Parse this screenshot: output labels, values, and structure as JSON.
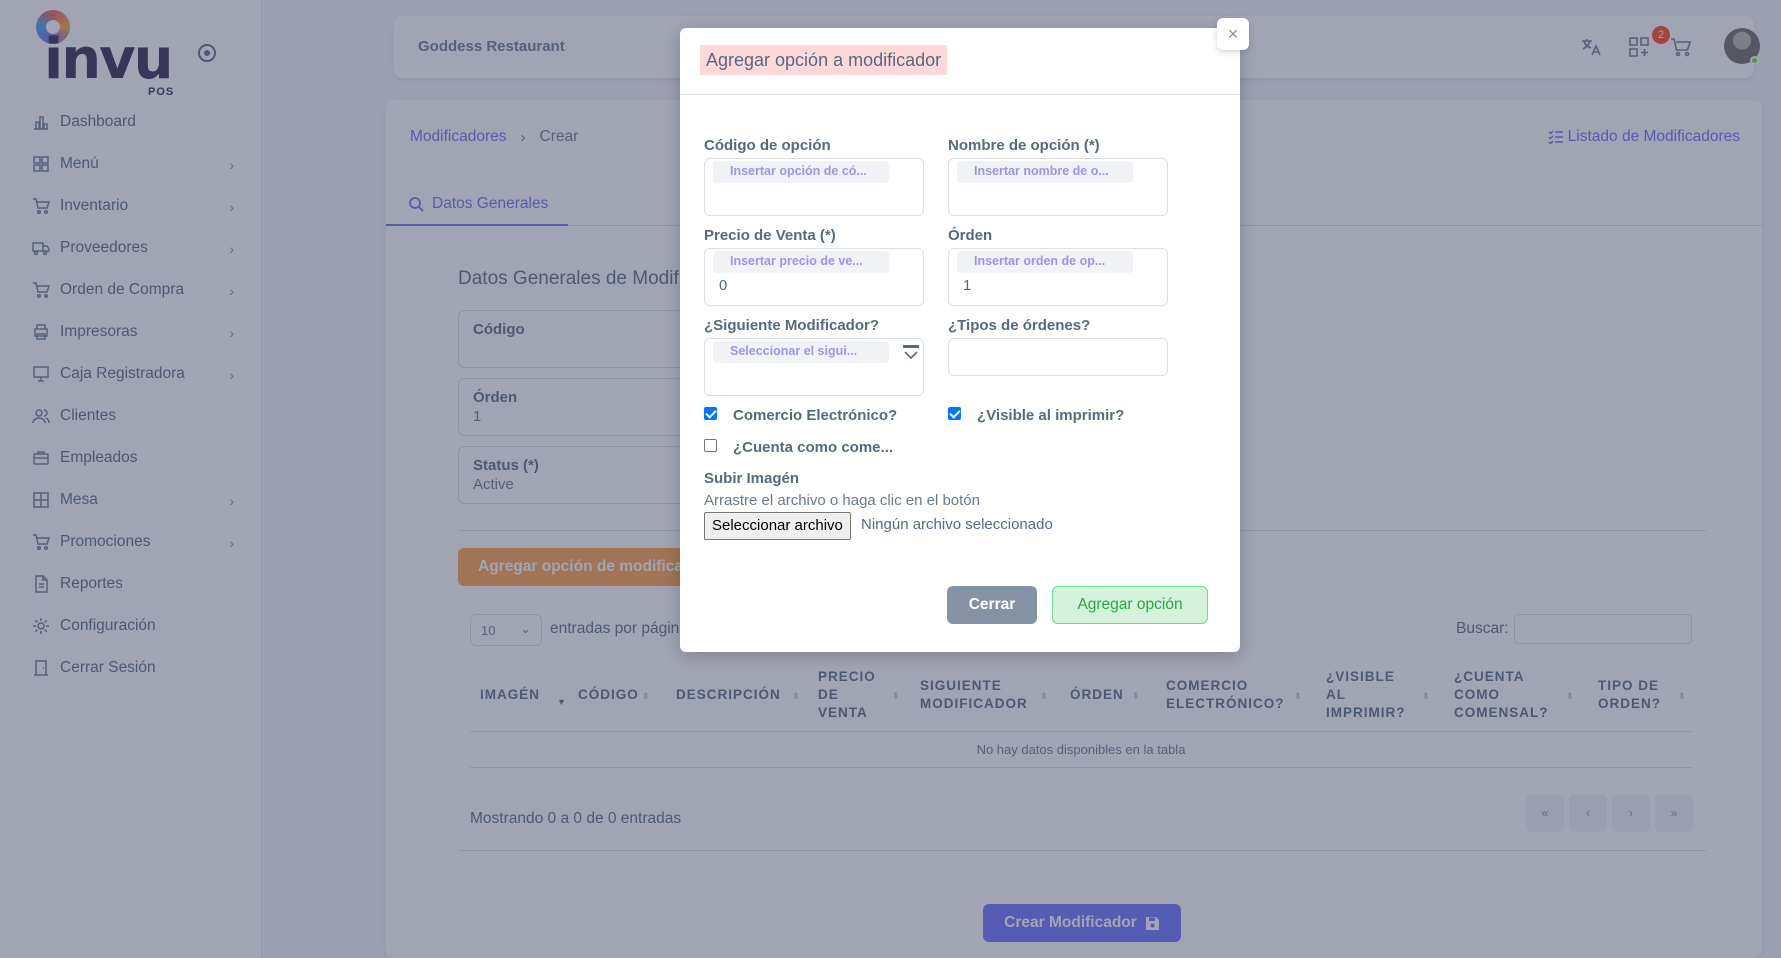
{
  "brand": {
    "logo_text": "invu",
    "logo_sub": "POS"
  },
  "sidebar": {
    "items": [
      {
        "label": "Dashboard",
        "icon": "bar-chart-icon",
        "has_submenu": false
      },
      {
        "label": "Menú",
        "icon": "grid-icon",
        "has_submenu": true
      },
      {
        "label": "Inventario",
        "icon": "cart-icon",
        "has_submenu": true
      },
      {
        "label": "Proveedores",
        "icon": "truck-icon",
        "has_submenu": true
      },
      {
        "label": "Orden de Compra",
        "icon": "cart-icon",
        "has_submenu": true
      },
      {
        "label": "Impresoras",
        "icon": "printer-icon",
        "has_submenu": true
      },
      {
        "label": "Caja Registradora",
        "icon": "monitor-icon",
        "has_submenu": true
      },
      {
        "label": "Clientes",
        "icon": "users-icon",
        "has_submenu": false
      },
      {
        "label": "Empleados",
        "icon": "briefcase-icon",
        "has_submenu": false
      },
      {
        "label": "Mesa",
        "icon": "table-icon",
        "has_submenu": true
      },
      {
        "label": "Promociones",
        "icon": "cart-icon",
        "has_submenu": true
      },
      {
        "label": "Reportes",
        "icon": "file-icon",
        "has_submenu": false
      },
      {
        "label": "Configuración",
        "icon": "gear-icon",
        "has_submenu": false
      },
      {
        "label": "Cerrar Sesión",
        "icon": "door-icon",
        "has_submenu": false
      }
    ]
  },
  "topbar": {
    "restaurant": "Goddess Restaurant",
    "cart_count": "2"
  },
  "page": {
    "breadcrumb_link": "Modificadores",
    "breadcrumb_current": "Crear",
    "list_link": "Listado de Modificadores",
    "tab": "Datos Generales",
    "section_title": "Datos Generales de Modificador",
    "fields": [
      {
        "label": "Código",
        "value": ""
      },
      {
        "label": "Órden",
        "value": "1"
      },
      {
        "label": "Status (*)",
        "value": "Active"
      }
    ],
    "add_option_button": "Agregar opción de modificador",
    "length_value": "10",
    "entries_text": "entradas por página",
    "search_label": "Buscar:",
    "table_headers": [
      "IMAGÉN",
      "CÓDIGO",
      "DESCRIPCIÓN",
      "PRECIO DE VENTA",
      "SIGUIENTE MODIFICADOR",
      "ÓRDEN",
      "COMERCIO ELECTRÓNICO?",
      "¿VISIBLE AL IMPRIMIR?",
      "¿CUENTA COMO COMENSAL?",
      "TIPO DE ORDEN?"
    ],
    "empty_text": "No hay datos disponibles en la tabla",
    "showing_text": "Mostrando 0 a 0 de 0 entradas",
    "pager": [
      "«",
      "‹",
      "›",
      "»"
    ],
    "create_button": "Crear Modificador"
  },
  "modal": {
    "title": "Agregar opción a modificador",
    "close_symbol": "×",
    "code_label": "Código de opción",
    "code_placeholder": "Insertar opción de có...",
    "name_label": "Nombre de opción (*)",
    "name_placeholder": "Insertar nombre de o...",
    "price_label": "Precio de Venta (*)",
    "price_placeholder": "Insertar precio de ve...",
    "price_value": "0",
    "order_label": "Órden",
    "order_placeholder": "Insertar orden de op...",
    "order_value": "1",
    "next_label": "¿Siguiente Modificador?",
    "next_placeholder": "Seleccionar el sigui...",
    "types_label": "¿Tipos de órdenes?",
    "ecommerce_label": "Comercio Electrónico?",
    "ecommerce_checked": true,
    "visible_label": "¿Visible al imprimir?",
    "visible_checked": true,
    "diner_label": "¿Cuenta como come...",
    "diner_checked": false,
    "upload_label": "Subir Imagén",
    "upload_hint": "Arrastre el archivo o haga clic en el botón",
    "file_button": "Seleccionar archivo",
    "file_status": "Ningún archivo seleccionado",
    "close_button": "Cerrar",
    "add_button": "Agregar opción"
  },
  "colors": {
    "primary": "#696cff",
    "orange": "#ff9f43",
    "success": "#28a745",
    "overlay": "#434968"
  }
}
